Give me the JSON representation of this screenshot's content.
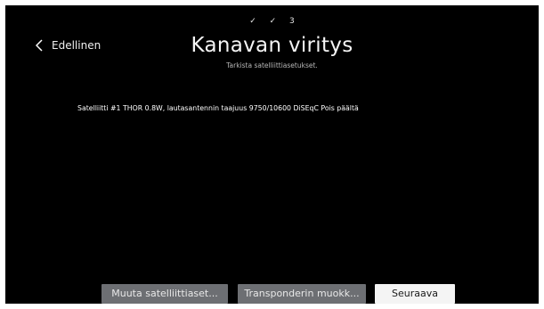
{
  "steps": {
    "step1": "✓",
    "step2": "✓",
    "step3": "3"
  },
  "back": {
    "label": "Edellinen",
    "icon": "chevron-left-icon"
  },
  "header": {
    "title": "Kanavan viritys",
    "subtitle": "Tarkista satelliittiasetukset."
  },
  "main": {
    "satellite_info": "Satelliitti #1 THOR 0.8W, lautasantennin taajuus 9750/10600 DiSEqC Pois päältä"
  },
  "buttons": {
    "change_satellite": "Muuta satelliittiaset...",
    "edit_transponder": "Transponderin muokk...",
    "next": "Seuraava"
  },
  "colors": {
    "background": "#000000",
    "button_grey": "#6d6f73",
    "button_focused": "#f4f4f4"
  }
}
